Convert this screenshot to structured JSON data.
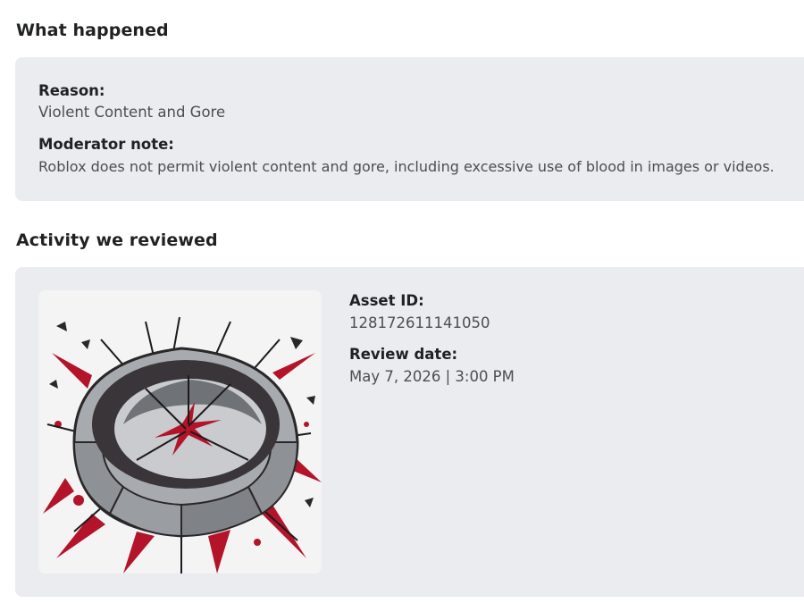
{
  "what_happened": {
    "heading": "What happened",
    "reason_label": "Reason:",
    "reason_value": "Violent Content and Gore",
    "note_label": "Moderator note:",
    "note_value": "Roblox does not permit violent content and gore, including excessive use of blood in images or videos."
  },
  "activity": {
    "heading": "Activity we reviewed",
    "asset_id_label": "Asset ID:",
    "asset_id_value": "128172611141050",
    "review_date_label": "Review date:",
    "review_date_value": "May 7, 2026 | 3:00 PM",
    "thumbnail_icon": "cracked-crater-with-blood-splatter-image"
  },
  "colors": {
    "card_background": "#ebecef",
    "heading_text": "#1f2123",
    "body_text": "#4b4e52",
    "blood_red": "#b3142a",
    "stone_gray": "#8e9196"
  }
}
